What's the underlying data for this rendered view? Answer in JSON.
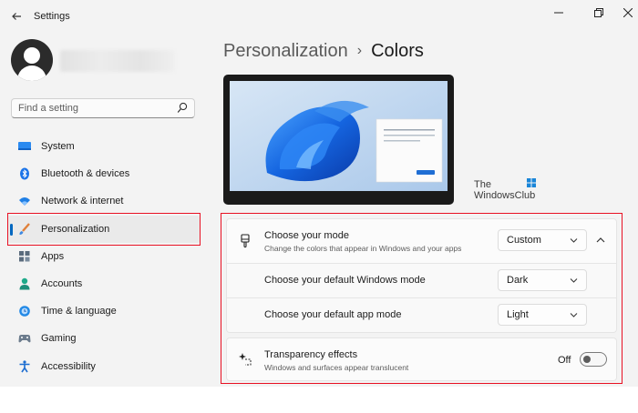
{
  "window": {
    "title": "Settings"
  },
  "search": {
    "placeholder": "Find a setting"
  },
  "sidebar": {
    "items": [
      {
        "label": "System",
        "icon": "monitor-icon"
      },
      {
        "label": "Bluetooth & devices",
        "icon": "bluetooth-icon"
      },
      {
        "label": "Network & internet",
        "icon": "wifi-icon"
      },
      {
        "label": "Personalization",
        "icon": "brush-icon",
        "selected": true
      },
      {
        "label": "Apps",
        "icon": "apps-grid-icon"
      },
      {
        "label": "Accounts",
        "icon": "person-icon"
      },
      {
        "label": "Time & language",
        "icon": "globe-clock-icon"
      },
      {
        "label": "Gaming",
        "icon": "gamepad-icon"
      },
      {
        "label": "Accessibility",
        "icon": "accessibility-icon"
      }
    ]
  },
  "breadcrumb": {
    "parent": "Personalization",
    "separator": "›",
    "current": "Colors"
  },
  "watermark": {
    "line1": "The",
    "line2": "WindowsClub"
  },
  "settings": {
    "mode": {
      "title": "Choose your mode",
      "description": "Change the colors that appear in Windows and your apps",
      "value": "Custom"
    },
    "windows_mode": {
      "title": "Choose your default Windows mode",
      "value": "Dark"
    },
    "app_mode": {
      "title": "Choose your default app mode",
      "value": "Light"
    },
    "transparency": {
      "title": "Transparency effects",
      "description": "Windows and surfaces appear translucent",
      "state_label": "Off",
      "enabled": false
    }
  },
  "colors": {
    "accent": "#0067c0",
    "highlight_border": "#e81123",
    "wallpaper_blue": "#1e6fe0"
  }
}
